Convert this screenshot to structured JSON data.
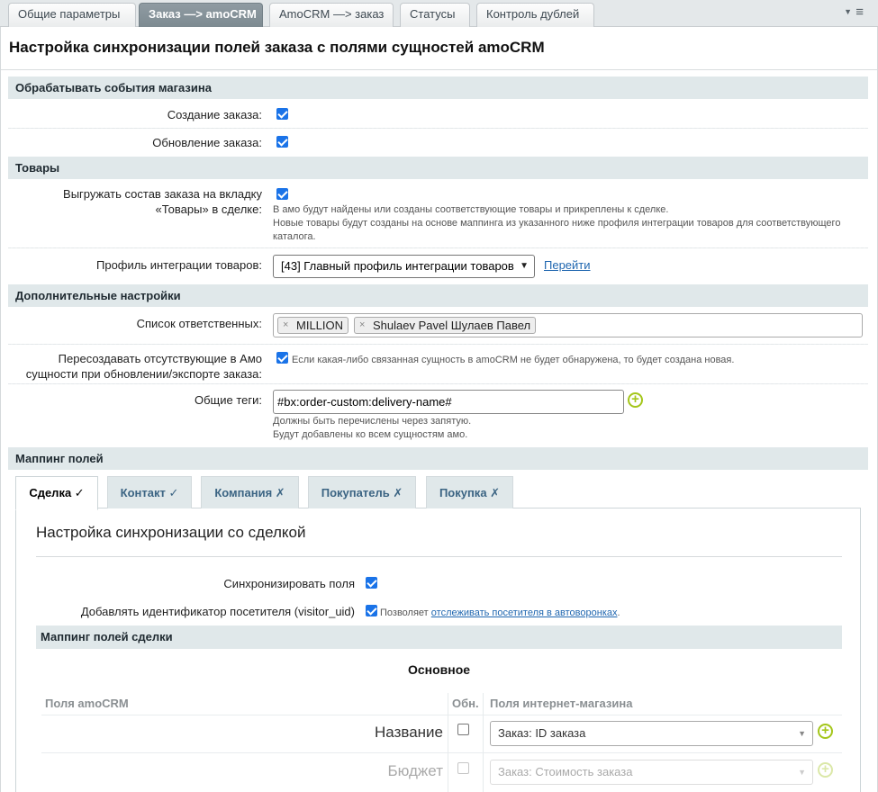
{
  "tabs": [
    {
      "label": "Общие параметры"
    },
    {
      "label": "Заказ —> amoCRM"
    },
    {
      "label": "AmoCRM —> заказ"
    },
    {
      "label": "Статусы"
    },
    {
      "label": "Контроль дублей"
    }
  ],
  "page_title": "Настройка синхронизации полей заказа с полями сущностей amoCRM",
  "sections": {
    "events": "Обрабатывать события магазина",
    "products": "Товары",
    "extra": "Дополнительные настройки",
    "mapping": "Маппинг полей"
  },
  "events": {
    "create_label": "Создание заказа:",
    "update_label": "Обновление заказа:"
  },
  "products": {
    "export_label": "Выгружать состав заказа на вкладку «Товары» в сделке:",
    "export_note_1": "В амо будут найдены или созданы соответствующие товары и прикреплены к сделке.",
    "export_note_2": "Новые товары будут созданы на основе маппинга из указанного ниже профиля интеграции товаров для соответствующего каталога.",
    "profile_label": "Профиль интеграции товаров:",
    "profile_value": "[43] Главный профиль интеграции товаров",
    "goto_link": "Перейти"
  },
  "extra": {
    "responsible_label": "Список ответственных:",
    "responsible_tags": [
      "MILLION",
      "Shulaev Pavel Шулаев Павел"
    ],
    "recreate_label": "Пересоздавать отсутствующие в Амо сущности при обновлении/экспорте заказа:",
    "recreate_note": "Если какая-либо связанная сущность в amoCRM не будет обнаружена, то будет создана новая.",
    "tags_label": "Общие теги:",
    "tags_value": "#bx:order-custom:delivery-name#",
    "tags_note_1": "Должны быть перечислены через запятую.",
    "tags_note_2": "Будут добавлены ко всем сущностям амо."
  },
  "subtabs": [
    {
      "label": "Сделка ✓"
    },
    {
      "label": "Контакт ✓"
    },
    {
      "label": "Компания ✗"
    },
    {
      "label": "Покупатель ✗"
    },
    {
      "label": "Покупка ✗"
    }
  ],
  "deal": {
    "title": "Настройка синхронизации со сделкой",
    "sync_label": "Синхронизировать поля",
    "visitor_label": "Добавлять идентификатор посетителя (visitor_uid)",
    "visitor_note_prefix": "Позволяет",
    "visitor_note_link": "отслеживать посетителя в автоворонках",
    "visitor_note_suffix": ".",
    "mapping_section": "Маппинг полей сделки",
    "group_title": "Основное",
    "col_amo": "Поля amoCRM",
    "col_upd": "Обн.",
    "col_shop": "Поля интернет-магазина",
    "rows": [
      {
        "name": "Название",
        "value": "Заказ: ID заказа"
      },
      {
        "name": "Бюджет",
        "value": "Заказ: Стоимость заказа"
      }
    ]
  }
}
